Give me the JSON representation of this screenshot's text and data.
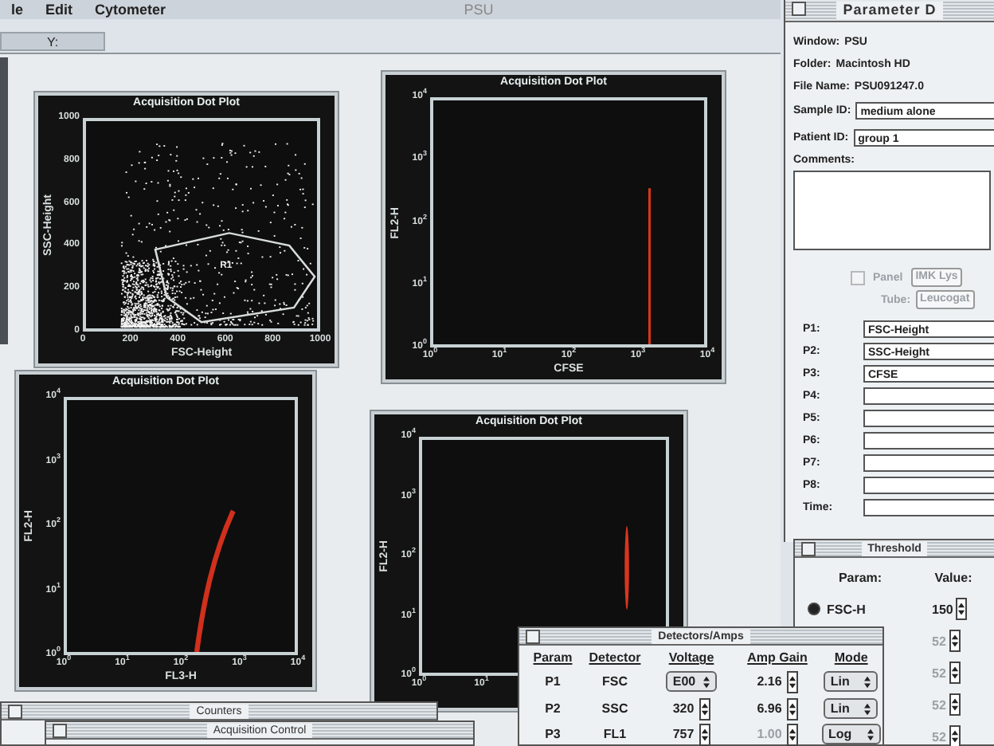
{
  "menu_bar": {
    "items": [
      "le",
      "Edit",
      "Cytometer"
    ]
  },
  "window": {
    "title": "PSU"
  },
  "toolbar": {
    "field_label": "Y:"
  },
  "plots": [
    {
      "kind": "gated-scatter",
      "title": "Acquisition Dot Plot",
      "ylabel": "SSC-Height",
      "xlabel": "FSC-Height",
      "yticks": [
        "1000",
        "800",
        "600",
        "400",
        "200",
        "0"
      ],
      "xticks": [
        "0",
        "200",
        "400",
        "600",
        "800",
        "1000"
      ],
      "gate_label": "R1"
    },
    {
      "kind": "vertical-line",
      "title": "Acquisition Dot Plot",
      "ylabel": "FL2-H",
      "xlabel": "CFSE",
      "yticks": [
        "10$^{4}$",
        "10$^{3}$",
        "10$^{2}$",
        "10$^{1}$",
        "10$^{0}$"
      ],
      "xticks": [
        "10$^{0}$",
        "10$^{1}$",
        "10$^{2}$",
        "10$^{3}$",
        "10$^{4}$"
      ]
    },
    {
      "kind": "curved-band",
      "title": "Acquisition Dot Plot",
      "ylabel": "FL2-H",
      "xlabel": "FL3-H",
      "yticks": [
        "10$^{4}$",
        "10$^{3}$",
        "10$^{2}$",
        "10$^{1}$",
        "10$^{0}$"
      ],
      "xticks": [
        "10$^{0}$",
        "10$^{1}$",
        "10$^{2}$",
        "10$^{3}$",
        "10$^{4}$"
      ]
    },
    {
      "kind": "streak",
      "title": "Acquisition Dot Plot",
      "ylabel": "FL2-H",
      "yticks": [
        "10$^{4}$",
        "10$^{3}$",
        "10$^{2}$",
        "10$^{1}$",
        "10$^{0}$"
      ],
      "xticks": [
        "10$^{0}$",
        "10$^{1}$"
      ]
    }
  ],
  "parameter_window": {
    "title": "Parameter D",
    "info": [
      {
        "label": "Window:",
        "value": "PSU"
      },
      {
        "label": "Folder:",
        "value": "Macintosh HD"
      },
      {
        "label": "File Name:",
        "value": "PSU091247.0"
      }
    ],
    "fields": [
      {
        "label": "Sample ID:",
        "value": "medium alone"
      },
      {
        "label": "Patient ID:",
        "value": "group 1"
      }
    ],
    "comments_label": "Comments:",
    "panel": {
      "label": "Panel",
      "value": "IMK Lys",
      "checked": false,
      "disabled": true
    },
    "tube": {
      "label": "Tube:",
      "value": "Leucogat",
      "disabled": true
    },
    "params": [
      {
        "label": "P1:",
        "value": "FSC-Height"
      },
      {
        "label": "P2:",
        "value": "SSC-Height"
      },
      {
        "label": "P3:",
        "value": "CFSE"
      },
      {
        "label": "P4:"
      },
      {
        "label": "P5:"
      },
      {
        "label": "P6:"
      },
      {
        "label": "P7:"
      },
      {
        "label": "P8:"
      },
      {
        "label": "Time:"
      }
    ]
  },
  "threshold_window": {
    "title": "Threshold",
    "headers": [
      "Param:",
      "Value:"
    ],
    "rows": [
      {
        "label": "FSC-H",
        "selected": true,
        "value": "150",
        "disabled": false
      },
      {
        "value": "52",
        "disabled": true
      },
      {
        "value": "52",
        "disabled": true
      },
      {
        "value": "52",
        "disabled": true
      },
      {
        "value": "52",
        "disabled": true
      }
    ]
  },
  "detectors_window": {
    "title": "Detectors/Amps",
    "columns": [
      "Param",
      "Detector",
      "Voltage",
      "Amp Gain",
      "Mode"
    ],
    "rows": [
      {
        "param": "P1",
        "detector": "FSC",
        "voltage": "E00",
        "kind": "popup",
        "gain": "2.16",
        "gain_disabled": false,
        "mode": "Lin"
      },
      {
        "param": "P2",
        "detector": "SSC",
        "voltage": "320",
        "kind": "stepper",
        "gain": "6.96",
        "gain_disabled": false,
        "mode": "Lin"
      },
      {
        "param": "P3",
        "detector": "FL1",
        "voltage": "757",
        "kind": "stepper",
        "gain": "1.00",
        "gain_disabled": true,
        "mode": "Log"
      }
    ]
  },
  "bottom_windows": [
    {
      "title": "Counters"
    },
    {
      "title": "Acquisition Control"
    }
  ]
}
